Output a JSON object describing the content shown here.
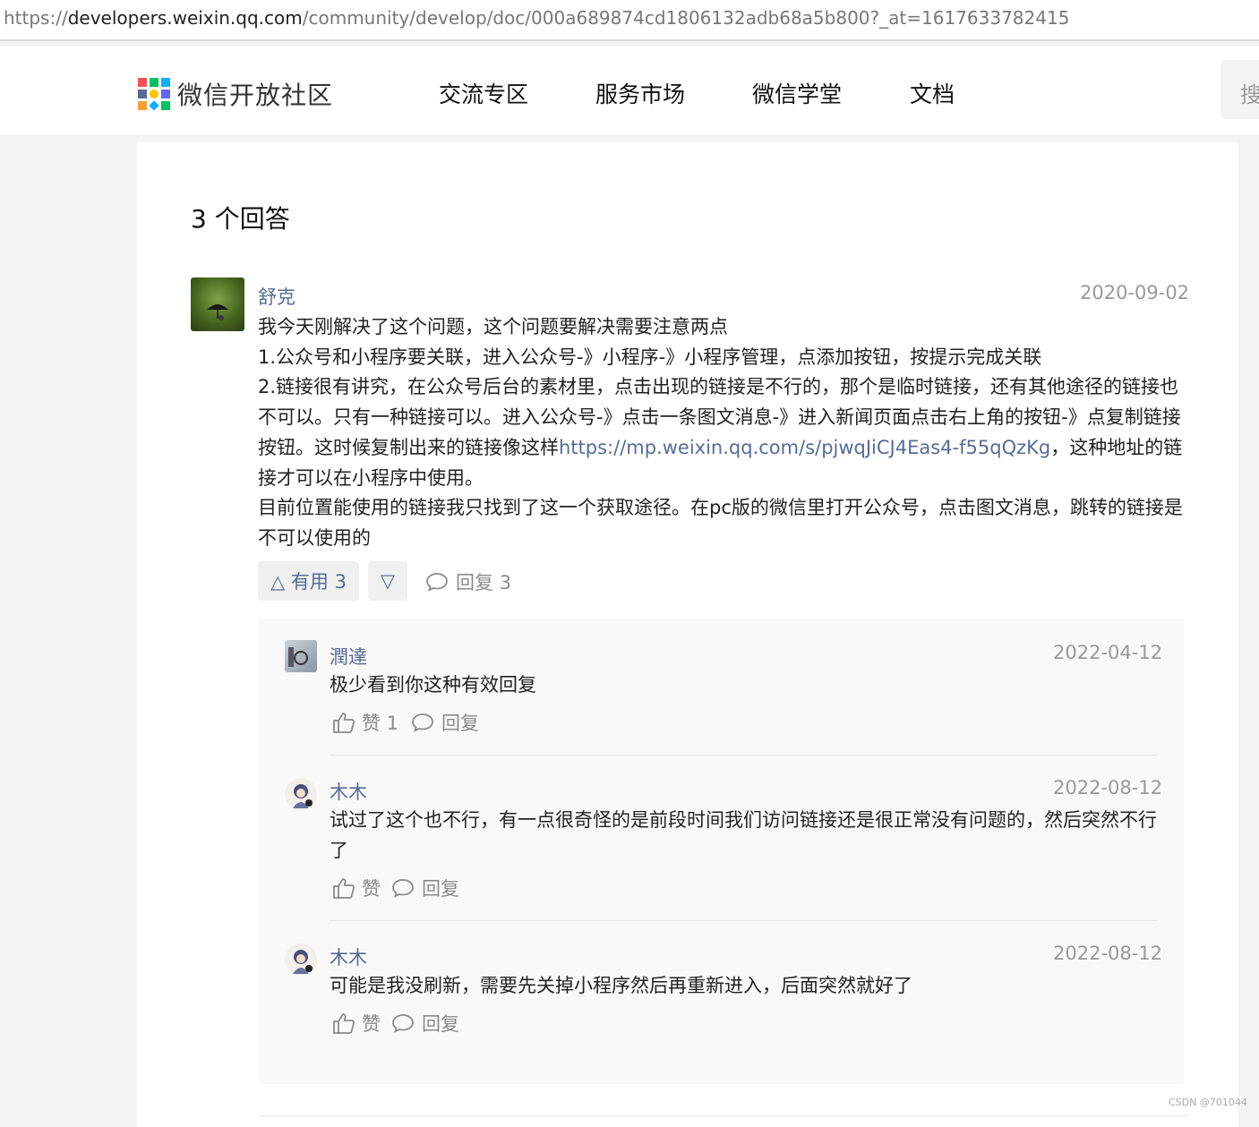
{
  "browser": {
    "url_scheme": "https://",
    "url_host": "developers.weixin.qq.com",
    "url_path": "/community/develop/doc/000a689874cd1806132adb68a5b800?_at=1617633782415"
  },
  "header": {
    "logo_text": "微信开放社区",
    "nav": [
      "交流专区",
      "服务市场",
      "微信学堂",
      "文档"
    ],
    "search_label": "搜"
  },
  "answers_title": "3 个回答",
  "answer": {
    "author": "舒克",
    "date": "2020-09-02",
    "lines": {
      "l1": "我今天刚解决了这个问题，这个问题要解决需要注意两点",
      "l2": "1.公众号和小程序要关联，进入公众号-》小程序-》小程序管理，点添加按钮，按提示完成关联",
      "l3a": "2.链接很有讲究，在公众号后台的素材里，点击出现的链接是不行的，那个是临时链接，还有其他途径的链接也不可以。只有一种链接可以。进入公众号-》点击一条图文消息-》进入新闻页面点击右上角的按钮-》点复制链接按钮。这时候复制出来的链接像这样",
      "link": "https://mp.weixin.qq.com/s/pjwqJiCJ4Eas4-f55qQzKg",
      "l3b": "，这种地址的链接才可以在小程序中使用。",
      "l4": "目前位置能使用的链接我只找到了这一个获取途径。在pc版的微信里打开公众号，点击图文消息，跳转的链接是不可以使用的"
    },
    "useful_label": "△ 有用 3",
    "down_label": "▽",
    "reply_label": "回复 3"
  },
  "comments": [
    {
      "author": "潤達",
      "date": "2022-04-12",
      "text": "极少看到你这种有效回复",
      "like_label": "赞 1",
      "reply_label": "回复"
    },
    {
      "author": "木木",
      "date": "2022-08-12",
      "text": "试过了这个也不行，有一点很奇怪的是前段时间我们访问链接还是很正常没有问题的，然后突然不行了",
      "like_label": "赞",
      "reply_label": "回复"
    },
    {
      "author": "木木",
      "date": "2022-08-12",
      "text": "可能是我没刷新，需要先关掉小程序然后再重新进入，后面突然就好了",
      "like_label": "赞",
      "reply_label": "回复"
    }
  ],
  "watermark": "CSDN @701044",
  "colors": {
    "link": "#576b95",
    "meta": "#999999",
    "panel": "#f9f9f9"
  },
  "icons": [
    "logo-icon",
    "comment-icon",
    "thumb-up-icon"
  ]
}
